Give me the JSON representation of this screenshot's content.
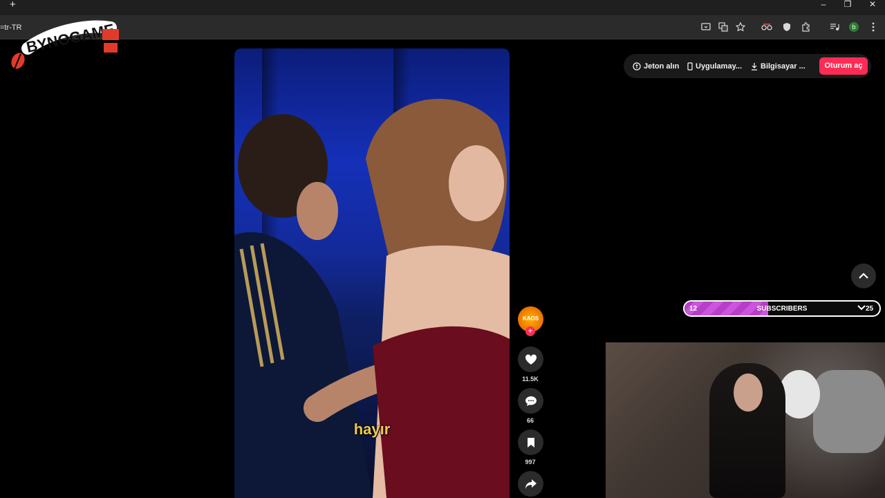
{
  "browser": {
    "url_fragment": "=tr-TR",
    "new_tab_symbol": "+",
    "profile_initial": "b",
    "window_controls": [
      "–",
      "❐",
      "✕"
    ]
  },
  "logo": {
    "text": "BYNOGAME"
  },
  "video": {
    "caption": "hayır"
  },
  "actions": {
    "avatar_text": "KAOS",
    "likes": "11.5K",
    "comments": "66",
    "saves": "997"
  },
  "topnav": {
    "coins": "Jeton alın",
    "app": "Uygulamay...",
    "desktop": "Bilgisayar ...",
    "login": "Oturum aç"
  },
  "subscribers": {
    "label": "SUBSCRIBERS",
    "start": "12",
    "end": "25",
    "progress": 0.43
  },
  "colors": {
    "accent": "#fe2c55",
    "progress": "#c04ad2"
  }
}
